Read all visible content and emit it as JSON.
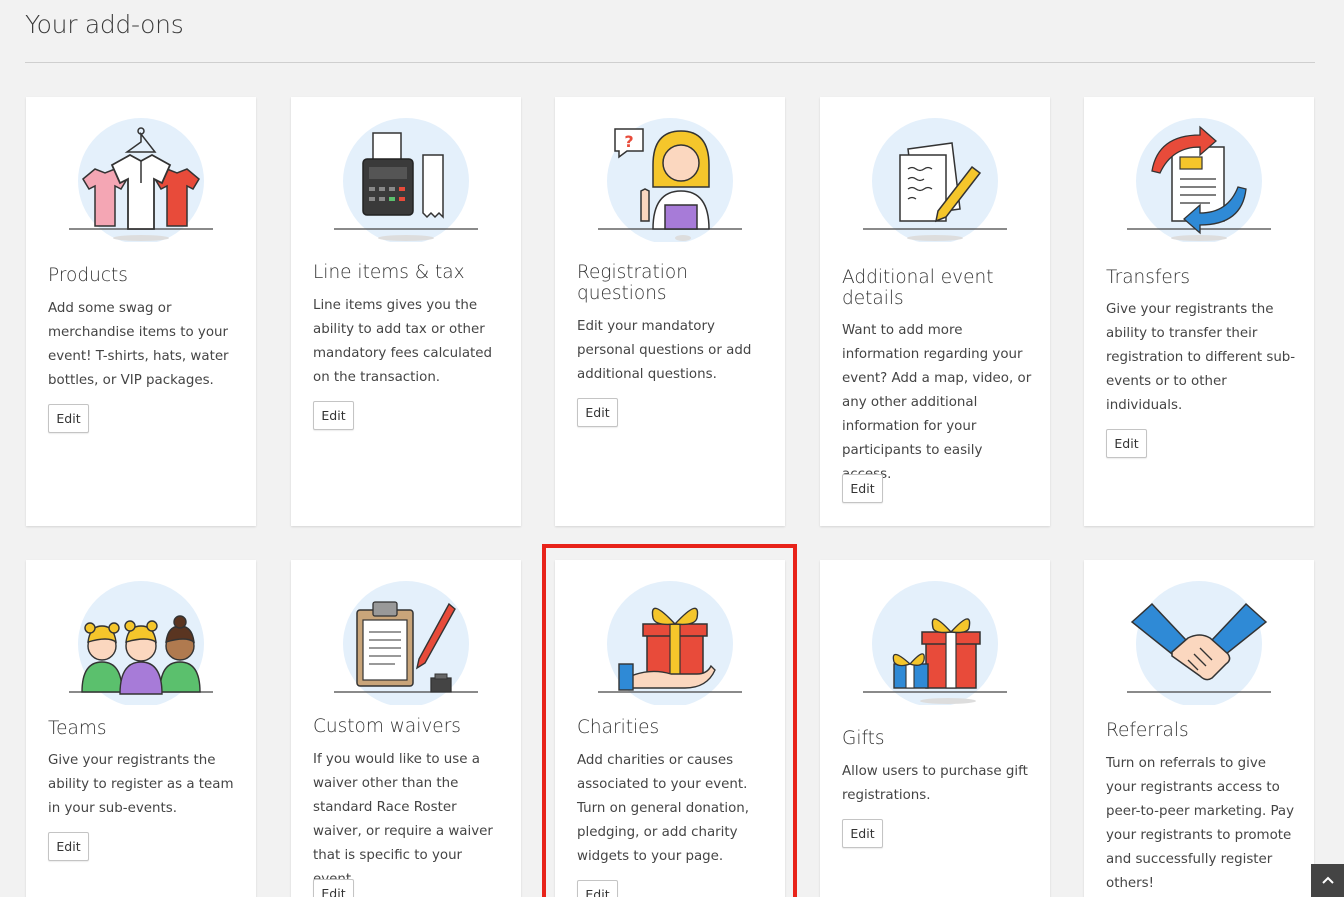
{
  "page": {
    "title": "Your add-ons"
  },
  "edit_label": "Edit",
  "colors": {
    "circle": "#e4f0fb",
    "highlight": "#e8231a",
    "accent_red": "#e84b3a",
    "accent_blue": "#2f8ad6",
    "accent_yellow": "#f5c62b"
  },
  "cards": [
    {
      "id": "products",
      "icon": "clothing-icon",
      "title": "Products",
      "description": "Add some swag or merchandise items to your event! T-shirts, hats, water bottles, or VIP packages."
    },
    {
      "id": "line-items",
      "icon": "cash-register-icon",
      "title": "Line items & tax",
      "description": "Line items gives you the ability to add tax or other mandatory fees calculated on the transaction."
    },
    {
      "id": "registration-questions",
      "icon": "question-person-icon",
      "title": "Registration questions",
      "description": "Edit your mandatory personal questions or add additional questions."
    },
    {
      "id": "additional-details",
      "icon": "document-pencil-icon",
      "title": "Additional event details",
      "description": "Want to add more information regarding your event? Add a map, video, or any other additional information for your participants to easily access."
    },
    {
      "id": "transfers",
      "icon": "transfer-document-icon",
      "title": "Transfers",
      "description": "Give your registrants the ability to transfer their registration to different sub-events or to other individuals."
    },
    {
      "id": "teams",
      "icon": "team-people-icon",
      "title": "Teams",
      "description": "Give your registrants the ability to register as a team in your sub-events."
    },
    {
      "id": "custom-waivers",
      "icon": "clipboard-pen-icon",
      "title": "Custom waivers",
      "description": "If you would like to use a waiver other than the standard Race Roster waiver, or require a waiver that is specific to your event."
    },
    {
      "id": "charities",
      "icon": "gift-hand-icon",
      "title": "Charities",
      "description": "Add charities or causes associated to your event. Turn on general donation, pledging, or add charity widgets to your page."
    },
    {
      "id": "gifts",
      "icon": "gift-boxes-icon",
      "title": "Gifts",
      "description": "Allow users to purchase gift registrations."
    },
    {
      "id": "referrals",
      "icon": "handshake-icon",
      "title": "Referrals",
      "description": "Turn on referrals to give your registrants access to peer-to-peer marketing. Pay your registrants to promote and successfully register others!"
    }
  ],
  "scroll_top_icon": "chevron-up-icon"
}
